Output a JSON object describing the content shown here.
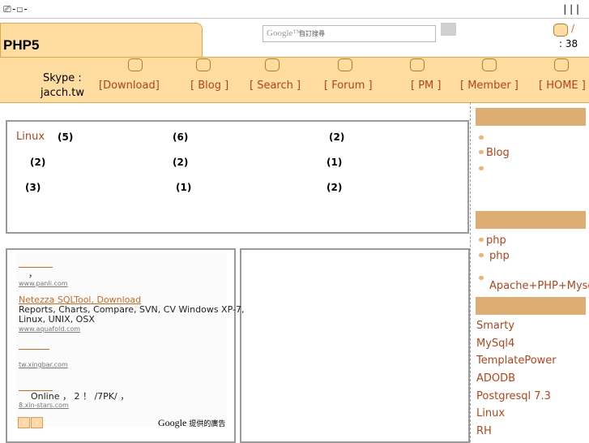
{
  "topbar": {
    "left_text": "⎚-☐-",
    "right_text": "| | |"
  },
  "header": {
    "logo": "PHP5",
    "search": {
      "brand": "Google™",
      "placeholder": "自訂搜尋"
    },
    "user": {
      "slash": "/",
      "count": ": 38"
    }
  },
  "nav": {
    "skype_label": "Skype :",
    "skype_id": "jacch.tw",
    "items": [
      {
        "label": "[Download]",
        "icon": "download-icon"
      },
      {
        "label": "[ Blog ]",
        "icon": "blog-icon"
      },
      {
        "label": "[ Search ]",
        "icon": "search-icon"
      },
      {
        "label": "[ Forum ]",
        "icon": "forum-icon"
      },
      {
        "label": "[ PM ]",
        "icon": "pm-icon"
      },
      {
        "label": "[ Member ]",
        "icon": "member-icon"
      },
      {
        "label": "[ HOME ]",
        "icon": "home-icon"
      }
    ]
  },
  "categories": {
    "first_link": "Linux",
    "counts": [
      "(5)",
      "(6)",
      "(2)",
      "(2)",
      "(2)",
      "(1)",
      "(3)",
      "(1)",
      "(2)"
    ]
  },
  "ads": {
    "ad1": {
      "text": "，",
      "url": "www.panli.com"
    },
    "ad2": {
      "title": "Netezza SQLTool, Download",
      "text1": "Reports, Charts, Compare, SVN, CV Windows XP-7,",
      "text2": "Linux, UNIX, OSX",
      "url": "www.aquafold.com"
    },
    "ad3": {
      "url": "tw.xingbar.com"
    },
    "ad4": {
      "text": "Online ， 2 ！ /7PK/ ，",
      "url": "8.xin-stars.com"
    },
    "prev": "‹",
    "next": "›",
    "brand": "Google",
    "brand_suffix": "提供的廣告"
  },
  "sidebar": {
    "section1": [
      "",
      "Blog",
      ""
    ],
    "section2": [
      "php",
      "php",
      "Apache+PHP+Mysql"
    ],
    "section3": [
      "Smarty",
      "MySql4",
      "TemplatePower",
      "ADODB",
      "Postgresql 7.3",
      "Linux",
      "RH"
    ]
  },
  "colors": {
    "accent": "#ffdca0",
    "border": "#e2a84a",
    "link": "#b5431a",
    "sidebar_header": "#ddad74"
  }
}
